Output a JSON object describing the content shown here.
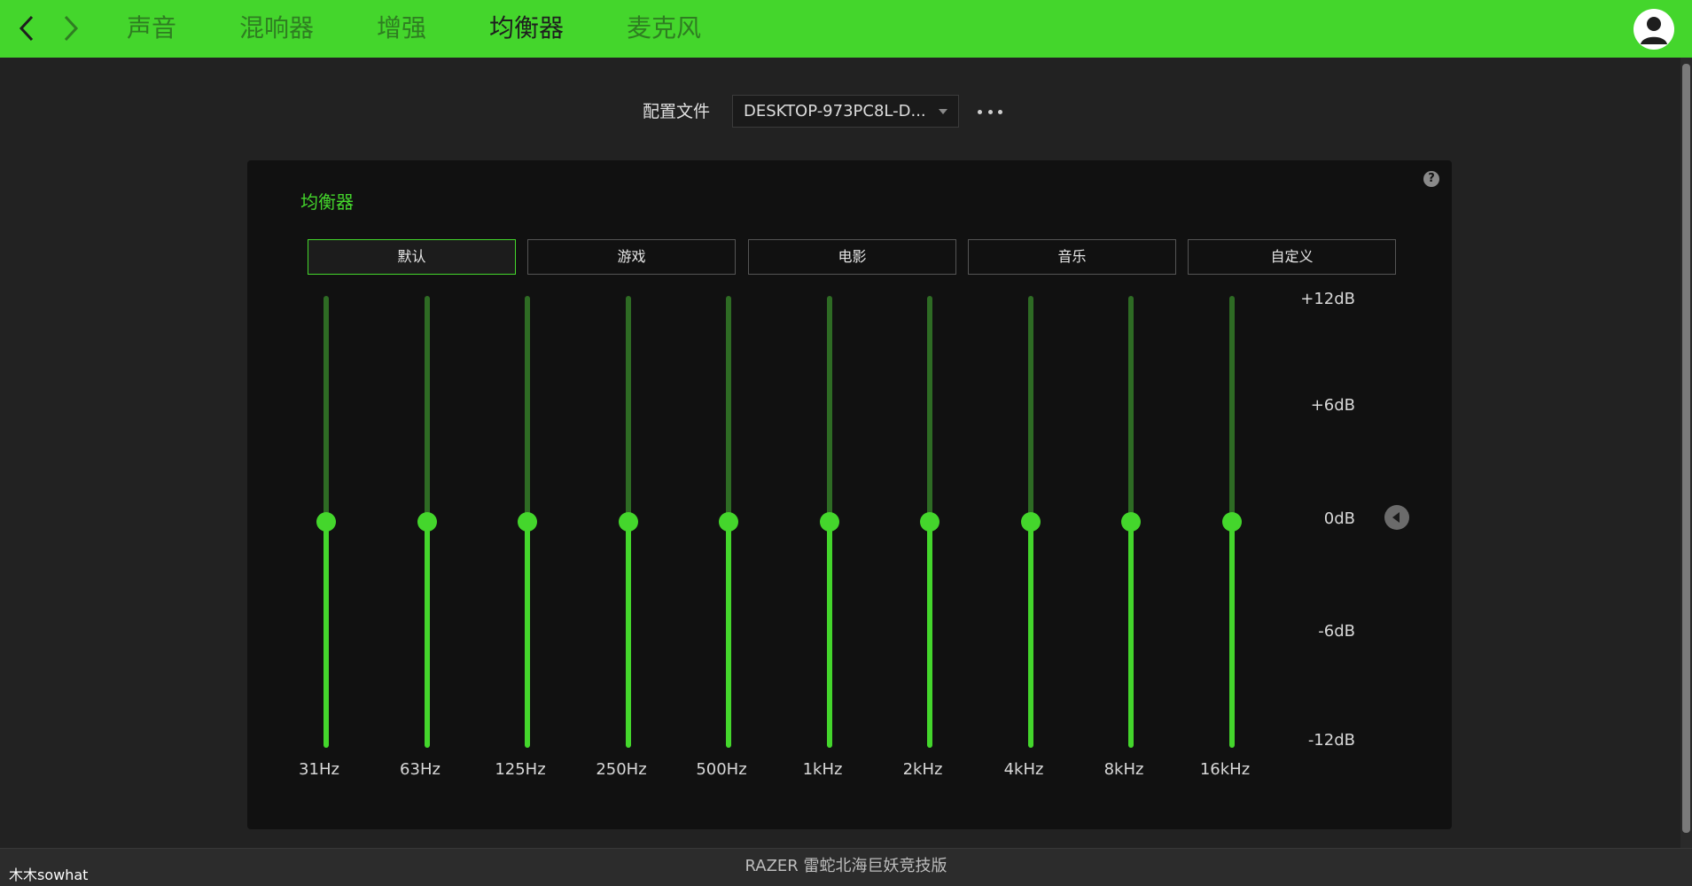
{
  "topbar": {
    "tabs": [
      {
        "label": "声音",
        "active": false
      },
      {
        "label": "混响器",
        "active": false
      },
      {
        "label": "增强",
        "active": false
      },
      {
        "label": "均衡器",
        "active": true
      },
      {
        "label": "麦克风",
        "active": false
      }
    ],
    "accent_color": "#44d62c"
  },
  "profile": {
    "label": "配置文件",
    "selected": "DESKTOP-973PC8L-D..."
  },
  "equalizer": {
    "title": "均衡器",
    "presets": [
      {
        "label": "默认",
        "active": true
      },
      {
        "label": "游戏",
        "active": false
      },
      {
        "label": "电影",
        "active": false
      },
      {
        "label": "音乐",
        "active": false
      },
      {
        "label": "自定义",
        "active": false
      }
    ],
    "db_scale": [
      "+12dB",
      "+6dB",
      "0dB",
      "-6dB",
      "-12dB"
    ],
    "db_range": [
      -12,
      12
    ],
    "bands": [
      {
        "freq": "31Hz",
        "gain_db": 0
      },
      {
        "freq": "63Hz",
        "gain_db": 0
      },
      {
        "freq": "125Hz",
        "gain_db": 0
      },
      {
        "freq": "250Hz",
        "gain_db": 0
      },
      {
        "freq": "500Hz",
        "gain_db": 0
      },
      {
        "freq": "1kHz",
        "gain_db": 0
      },
      {
        "freq": "2kHz",
        "gain_db": 0
      },
      {
        "freq": "4kHz",
        "gain_db": 0
      },
      {
        "freq": "8kHz",
        "gain_db": 0
      },
      {
        "freq": "16kHz",
        "gain_db": 0
      }
    ]
  },
  "footer": {
    "device_name": "RAZER 雷蛇北海巨妖竞技版",
    "watermark": "木木sowhat"
  }
}
